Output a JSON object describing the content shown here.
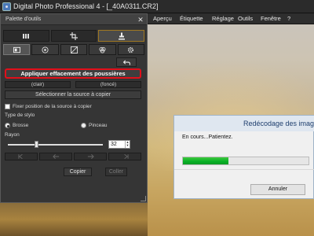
{
  "window": {
    "title": "Digital Photo Professional 4 - [_40A0311.CR2]"
  },
  "menubar": {
    "items": [
      "Aperçu",
      "Étiquette",
      "Réglage",
      "Outils",
      "Fenêtre",
      "?"
    ]
  },
  "palette": {
    "title": "Palette d'outils",
    "close_glyph": "✕",
    "top_tabs": [
      {
        "icon": "adjust-image-icon",
        "active": false
      },
      {
        "icon": "crop-icon",
        "active": false
      },
      {
        "icon": "stamp-icon",
        "active": true
      }
    ],
    "tool_tabs": [
      {
        "icon": "basic-adjust-icon",
        "active": true
      },
      {
        "icon": "lens-correction-icon",
        "active": false
      },
      {
        "icon": "tone-curve-icon",
        "active": false
      },
      {
        "icon": "color-adjust-icon",
        "active": false
      },
      {
        "icon": "settings-gear-icon",
        "active": false
      }
    ],
    "undo_icon": "undo-arrow-icon",
    "apply_dust_label": "Appliquer effacement des poussières",
    "light_label": "(clair)",
    "dark_label": "(foncé)",
    "select_source_label": "Sélectionner la source à copier",
    "fix_source_label": "Fixer position de la source à copier",
    "fix_source_checked": false,
    "pen_type_label": "Type de stylo",
    "brush_label": "Brosse",
    "brush_selected": true,
    "pencil_label": "Pinceau",
    "pencil_selected": false,
    "radius_label": "Rayon",
    "radius_value": "32",
    "radius_slider_fraction": 0.3,
    "nav_buttons": [
      "first-icon",
      "previous-icon",
      "next-icon",
      "last-icon"
    ],
    "copy_label": "Copier",
    "paste_label": "Coller",
    "paste_disabled": true
  },
  "dialog": {
    "title": "Redécodage des images",
    "message": "En cours...Patientez.",
    "progress_fraction": 0.36,
    "cancel_label": "Annuler"
  },
  "colors": {
    "highlight_border": "#e10f1a",
    "progress_green": "#06b025",
    "active_tab_border": "#a07822"
  }
}
